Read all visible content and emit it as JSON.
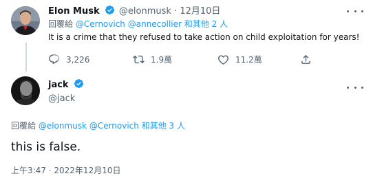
{
  "reply_tweet": {
    "author_name": "Elon Musk",
    "author_handle": "@elonmusk",
    "separator": "·",
    "date": "12月10日",
    "reply_prefix": "回覆給",
    "reply_mentions": "@Cernovich @annecollier",
    "reply_suffix": "和其他 2 人",
    "text": "It is a crime that they refused to take action on child exploitation for years!",
    "actions": {
      "replies": "3,226",
      "retweets": "1.9萬",
      "likes": "11.2萬"
    }
  },
  "main_tweet": {
    "author_name": "jack",
    "author_handle": "@jack",
    "reply_prefix": "回覆給",
    "reply_mentions": "@elonmusk @Cernovich",
    "reply_suffix": "和其他 3 人",
    "text": "this is false.",
    "timestamp": "上午3:47 · 2022年12月10日"
  },
  "icons": [
    "verified-badge-icon",
    "more-icon",
    "reply-icon",
    "retweet-icon",
    "like-icon",
    "share-icon"
  ],
  "colors": {
    "accent": "#1d9bf0",
    "muted": "#536471",
    "text": "#0f1419",
    "thread_line": "#cfd9de"
  }
}
